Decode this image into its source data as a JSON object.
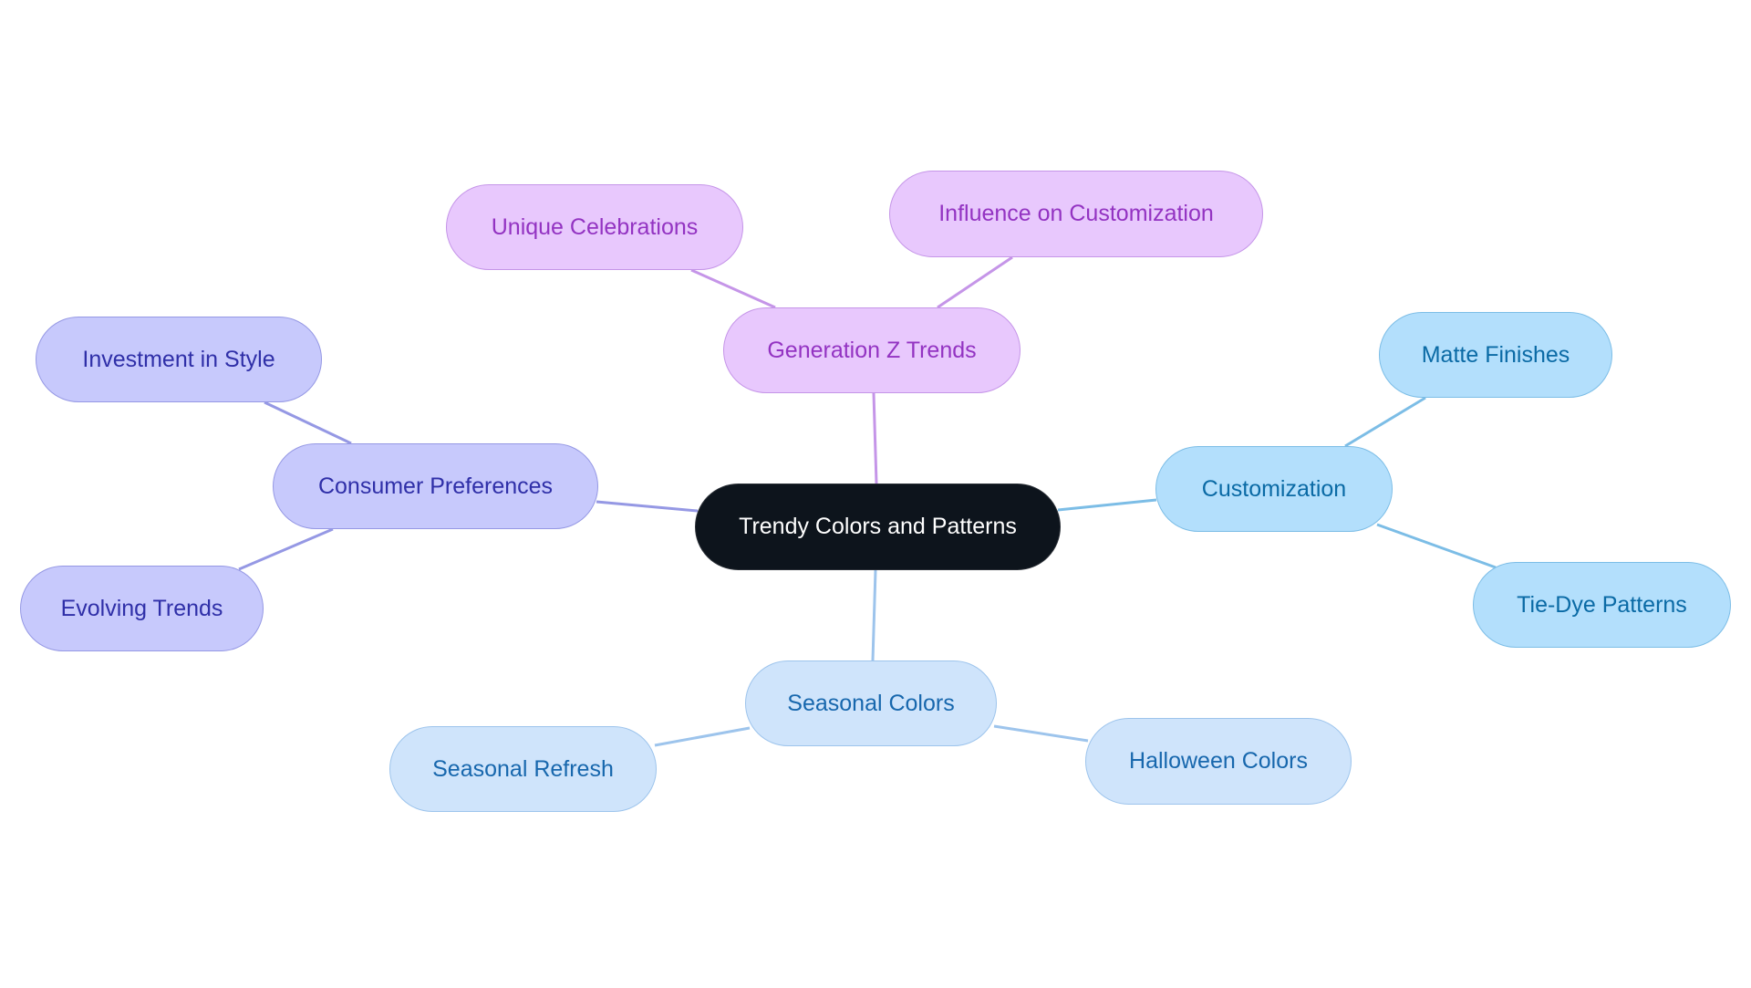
{
  "diagram": {
    "type": "mindmap",
    "root": {
      "id": "root",
      "label": "Trendy Colors and Patterns"
    },
    "branches": [
      {
        "id": "genz",
        "label": "Generation Z Trends",
        "color": "#c595e8",
        "children": [
          {
            "id": "unique",
            "label": "Unique Celebrations"
          },
          {
            "id": "influence",
            "label": "Influence on Customization"
          }
        ]
      },
      {
        "id": "consumer",
        "label": "Consumer Preferences",
        "color": "#9598e4",
        "children": [
          {
            "id": "investment",
            "label": "Investment in Style"
          },
          {
            "id": "evolving",
            "label": "Evolving Trends"
          }
        ]
      },
      {
        "id": "custom",
        "label": "Customization",
        "color": "#7cbde6",
        "children": [
          {
            "id": "matte",
            "label": "Matte Finishes"
          },
          {
            "id": "tiedye",
            "label": "Tie-Dye Patterns"
          }
        ]
      },
      {
        "id": "seasonal",
        "label": "Seasonal Colors",
        "color": "#9dc4ec",
        "children": [
          {
            "id": "refresh",
            "label": "Seasonal Refresh"
          },
          {
            "id": "halloween",
            "label": "Halloween Colors"
          }
        ]
      }
    ]
  }
}
